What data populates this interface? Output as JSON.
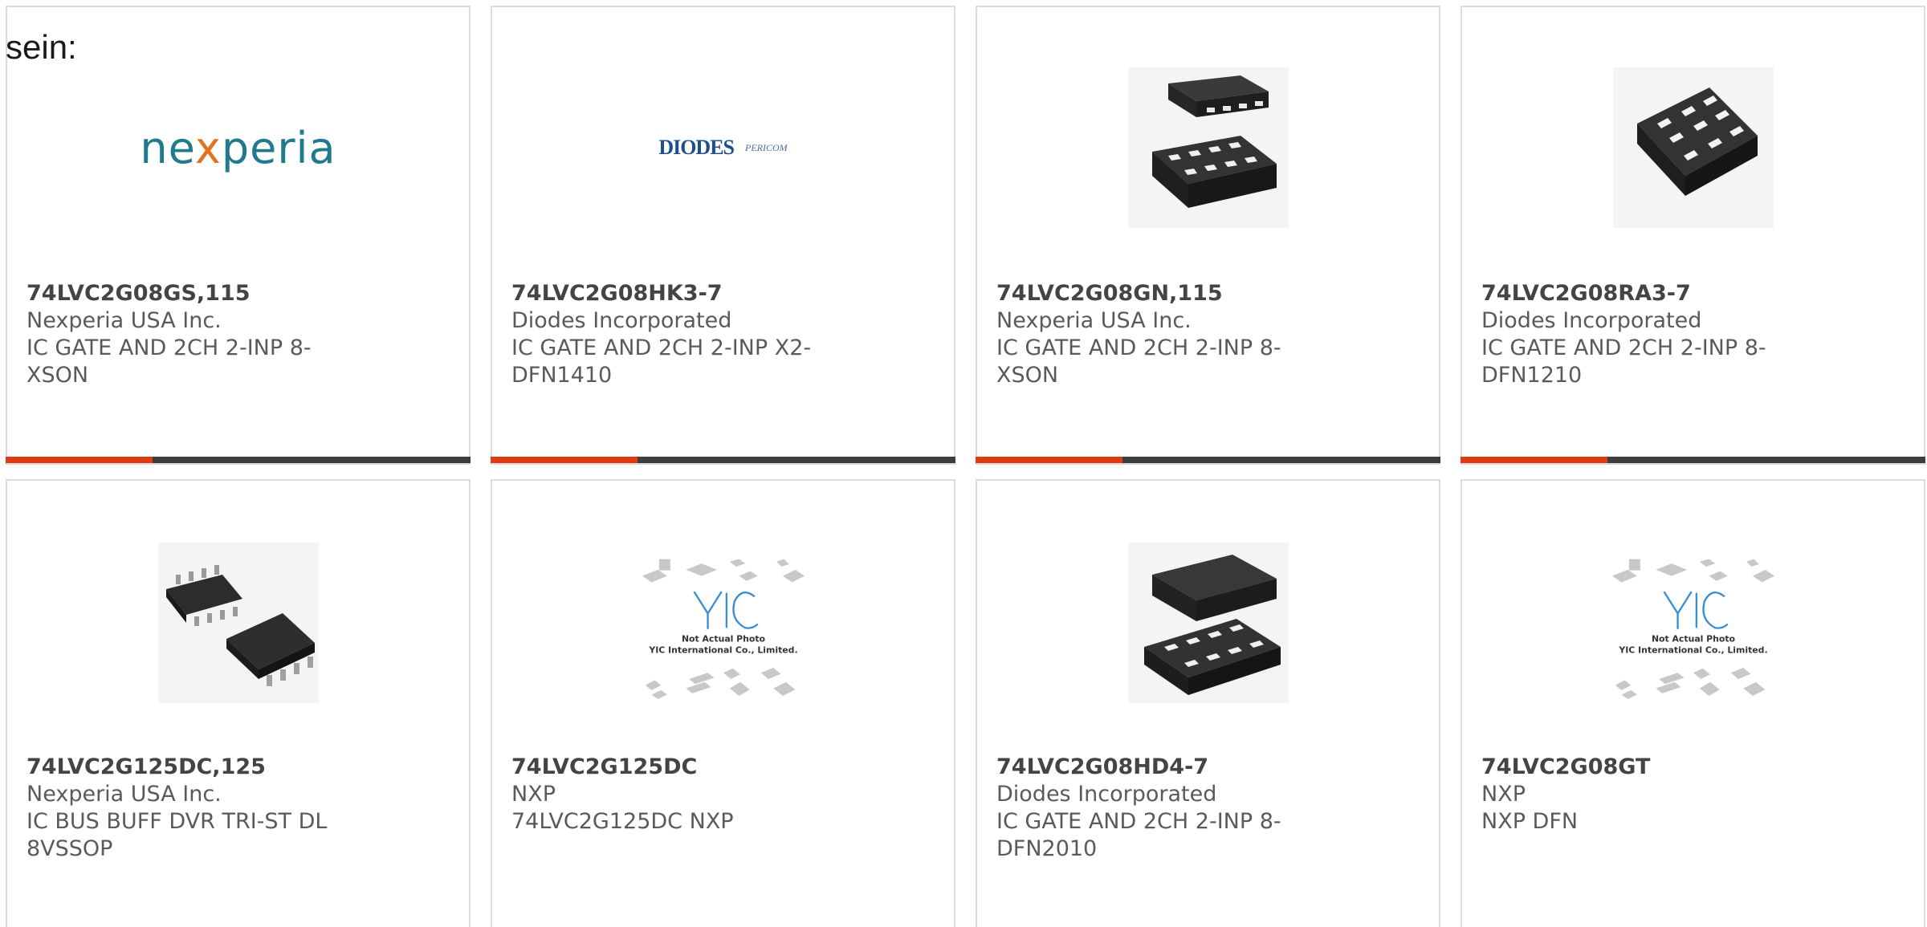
{
  "intro": "sein:",
  "products": [
    {
      "part": "74LVC2G08GS,115",
      "maker": "Nexperia USA Inc.",
      "desc": "IC GATE AND 2CH 2-INP 8-XSON",
      "image": "nexperia-logo",
      "logo_text": {
        "a": "ne",
        "b": "x",
        "c": "peria"
      }
    },
    {
      "part": "74LVC2G08HK3-7",
      "maker": "Diodes Incorporated",
      "desc": "IC GATE AND 2CH 2-INP X2-DFN1410",
      "image": "diodes-pericom-logo",
      "logo_text": {
        "a": "DIODES",
        "b": "PERICOM"
      }
    },
    {
      "part": "74LVC2G08GN,115",
      "maker": "Nexperia USA Inc.",
      "desc": "IC GATE AND 2CH 2-INP 8-XSON",
      "image": "chip-xson-photo"
    },
    {
      "part": "74LVC2G08RA3-7",
      "maker": "Diodes Incorporated",
      "desc": "IC GATE AND 2CH 2-INP 8-DFN1210",
      "image": "chip-dfn-photo"
    },
    {
      "part": "74LVC2G125DC,125",
      "maker": "Nexperia USA Inc.",
      "desc": "IC BUS BUFF DVR TRI-ST DL 8VSSOP",
      "image": "chip-vssop-photo"
    },
    {
      "part": "74LVC2G125DC",
      "maker": "NXP",
      "desc": "74LVC2G125DC NXP",
      "image": "not-actual-photo-placeholder",
      "placeholder_text": {
        "line1": "Not Actual Photo",
        "line2": "YIC International Co., Limited.",
        "mark": "YIC"
      }
    },
    {
      "part": "74LVC2G08HD4-7",
      "maker": "Diodes Incorporated",
      "desc": "IC GATE AND 2CH 2-INP 8-DFN2010",
      "image": "chip-dfn2010-photo"
    },
    {
      "part": "74LVC2G08GT",
      "maker": "NXP",
      "desc": "NXP DFN",
      "image": "not-actual-photo-placeholder",
      "placeholder_text": {
        "line1": "Not Actual Photo",
        "line2": "YIC International Co., Limited.",
        "mark": "YIC"
      }
    }
  ],
  "colors": {
    "accent_bar": "#e03a12",
    "dark_bar": "#3d3d3d",
    "nexperia_teal": "#1f7a8c",
    "nexperia_orange": "#e2731f"
  }
}
